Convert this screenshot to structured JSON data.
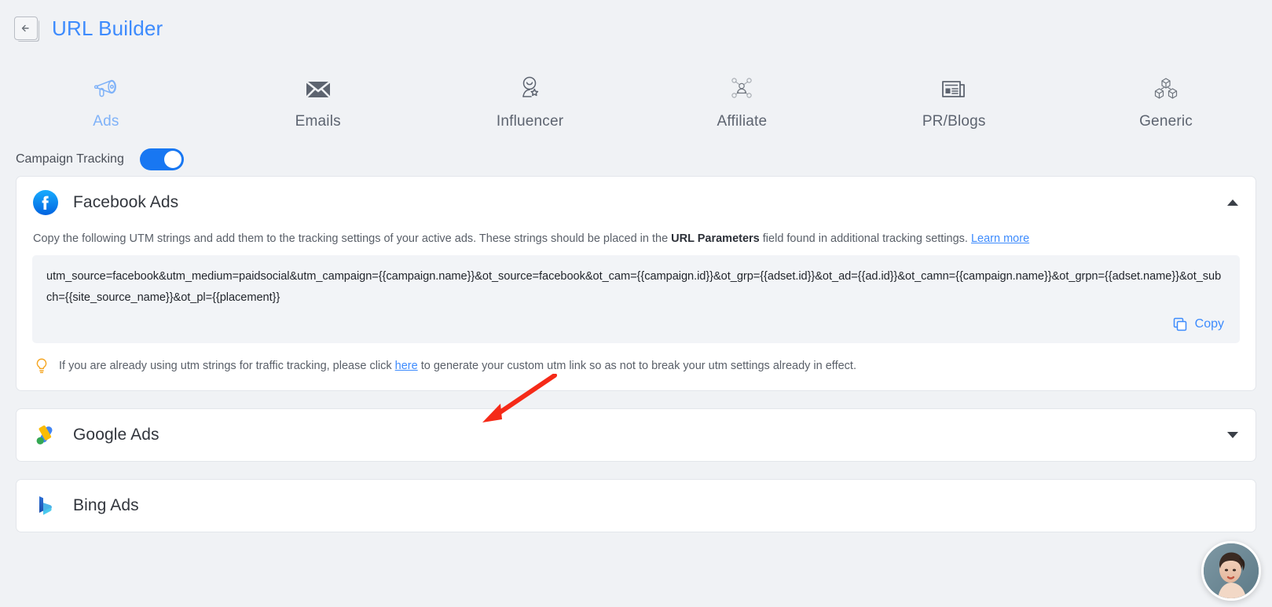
{
  "header": {
    "back_icon": "back-arrow-icon",
    "title": "URL Builder"
  },
  "tabs": [
    {
      "label": "Ads",
      "icon": "megaphone-icon",
      "active": true
    },
    {
      "label": "Emails",
      "icon": "envelope-icon",
      "active": false
    },
    {
      "label": "Influencer",
      "icon": "influencer-icon",
      "active": false
    },
    {
      "label": "Affiliate",
      "icon": "affiliate-network-icon",
      "active": false
    },
    {
      "label": "PR/Blogs",
      "icon": "newspaper-icon",
      "active": false
    },
    {
      "label": "Generic",
      "icon": "cubes-icon",
      "active": false
    }
  ],
  "tracking": {
    "label": "Campaign Tracking",
    "enabled": true
  },
  "cards": [
    {
      "title": "Facebook Ads",
      "logo": "facebook-logo-icon",
      "expanded": true,
      "description_parts": {
        "part1": "Copy the following UTM strings and add them to the tracking settings of your active ads. These strings should be placed in the ",
        "bold": "URL Parameters",
        "part2": " field found in additional tracking settings. ",
        "link": "Learn more"
      },
      "utm_string": "utm_source=facebook&utm_medium=paidsocial&utm_campaign={{campaign.name}}&ot_source=facebook&ot_cam={{campaign.id}}&ot_grp={{adset.id}}&ot_ad={{ad.id}}&ot_camn={{campaign.name}}&ot_grpn={{adset.name}}&ot_subch={{site_source_name}}&ot_pl={{placement}}",
      "copy_label": "Copy",
      "copy_icon": "copy-icon",
      "hint": {
        "icon": "lightbulb-icon",
        "part1": "If you are already using utm strings for traffic tracking, please click ",
        "link": "here",
        "part2": " to generate your custom utm link so as not to break your utm settings already in effect."
      }
    },
    {
      "title": "Google Ads",
      "logo": "google-ads-logo-icon",
      "expanded": false
    },
    {
      "title": "Bing Ads",
      "logo": "bing-logo-icon",
      "expanded": false
    }
  ],
  "annotation": {
    "arrow": "red-arrow-annotation",
    "color": "#f52a18"
  },
  "avatar_widget": {
    "name": "support-avatar-widget"
  },
  "colors": {
    "accent": "#3d8bfd",
    "toggle_on": "#1877f2",
    "page_bg": "#f0f2f5",
    "card_bg": "#ffffff",
    "utm_bg": "#f2f4f7"
  }
}
